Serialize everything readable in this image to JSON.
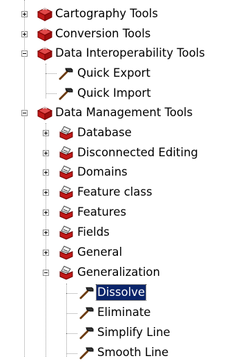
{
  "tree": {
    "toolboxes": [
      {
        "label": "Cartography Tools",
        "state": "collapsed"
      },
      {
        "label": "Conversion Tools",
        "state": "collapsed"
      },
      {
        "label": "Data Interoperability Tools",
        "state": "expanded",
        "tools": [
          {
            "label": "Quick Export"
          },
          {
            "label": "Quick Import"
          }
        ]
      },
      {
        "label": "Data Management Tools",
        "state": "expanded",
        "toolsets": [
          {
            "label": "Database",
            "state": "collapsed"
          },
          {
            "label": "Disconnected Editing",
            "state": "collapsed"
          },
          {
            "label": "Domains",
            "state": "collapsed"
          },
          {
            "label": "Feature class",
            "state": "collapsed"
          },
          {
            "label": "Features",
            "state": "collapsed"
          },
          {
            "label": "Fields",
            "state": "collapsed"
          },
          {
            "label": "General",
            "state": "collapsed"
          },
          {
            "label": "Generalization",
            "state": "expanded",
            "tools": [
              {
                "label": "Dissolve",
                "selected": true
              },
              {
                "label": "Eliminate"
              },
              {
                "label": "Simplify Line"
              },
              {
                "label": "Smooth Line"
              }
            ]
          }
        ]
      }
    ]
  },
  "icons": {
    "toolbox": "red-toolbox-icon",
    "toolset": "open-toolset-icon",
    "tool": "hammer-icon"
  },
  "colors": {
    "selection_bg": "#0a246a",
    "selection_text": "#ffffff",
    "toolbox_red": "#c41e1e"
  }
}
